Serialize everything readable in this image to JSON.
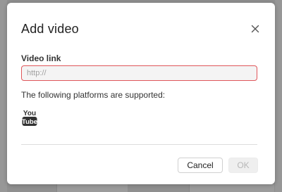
{
  "dialog": {
    "title": "Add video",
    "close_icon": "close-icon",
    "video_link": {
      "label": "Video link",
      "placeholder": "http://",
      "value": ""
    },
    "platforms_text": "The following platforms are supported:",
    "platforms": [
      {
        "name": "YouTube",
        "icon": "youtube-icon",
        "lines": [
          "You",
          "Tube"
        ]
      }
    ],
    "buttons": {
      "cancel": "Cancel",
      "ok": "OK"
    }
  },
  "colors": {
    "overlay": "#8f8f8f",
    "error_border": "#e0565a",
    "input_bg": "#f4f4f4",
    "disabled_text": "#b8b8b8"
  }
}
